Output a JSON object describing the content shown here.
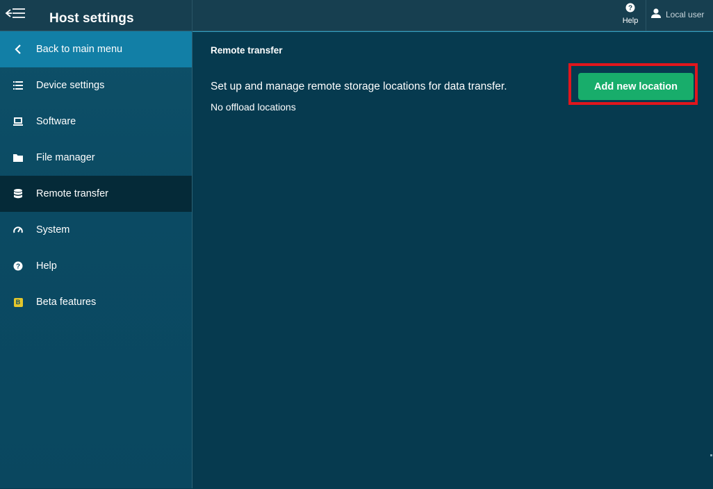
{
  "header": {
    "title": "Host settings",
    "help_label": "Help",
    "user_label": "Local user"
  },
  "sidebar": {
    "items": [
      {
        "label": "Back to main menu",
        "icon": "chevron-left-icon"
      },
      {
        "label": "Device settings",
        "icon": "list-icon"
      },
      {
        "label": "Software",
        "icon": "laptop-icon"
      },
      {
        "label": "File manager",
        "icon": "folder-icon"
      },
      {
        "label": "Remote transfer",
        "icon": "database-icon",
        "active": true
      },
      {
        "label": "System",
        "icon": "gauge-icon"
      },
      {
        "label": "Help",
        "icon": "help-circle-icon"
      },
      {
        "label": "Beta features",
        "icon": "beta-badge-icon",
        "badge_text": "B"
      }
    ]
  },
  "main": {
    "section_title": "Remote transfer",
    "description": "Set up and manage remote storage locations for data transfer.",
    "empty_text": "No offload locations",
    "add_button_label": "Add new location"
  },
  "colors": {
    "accent": "#127fa6",
    "primary_button": "#18ad6b",
    "highlight": "#e0161d",
    "background": "#063a4f",
    "beta_badge": "#e3c62b"
  }
}
